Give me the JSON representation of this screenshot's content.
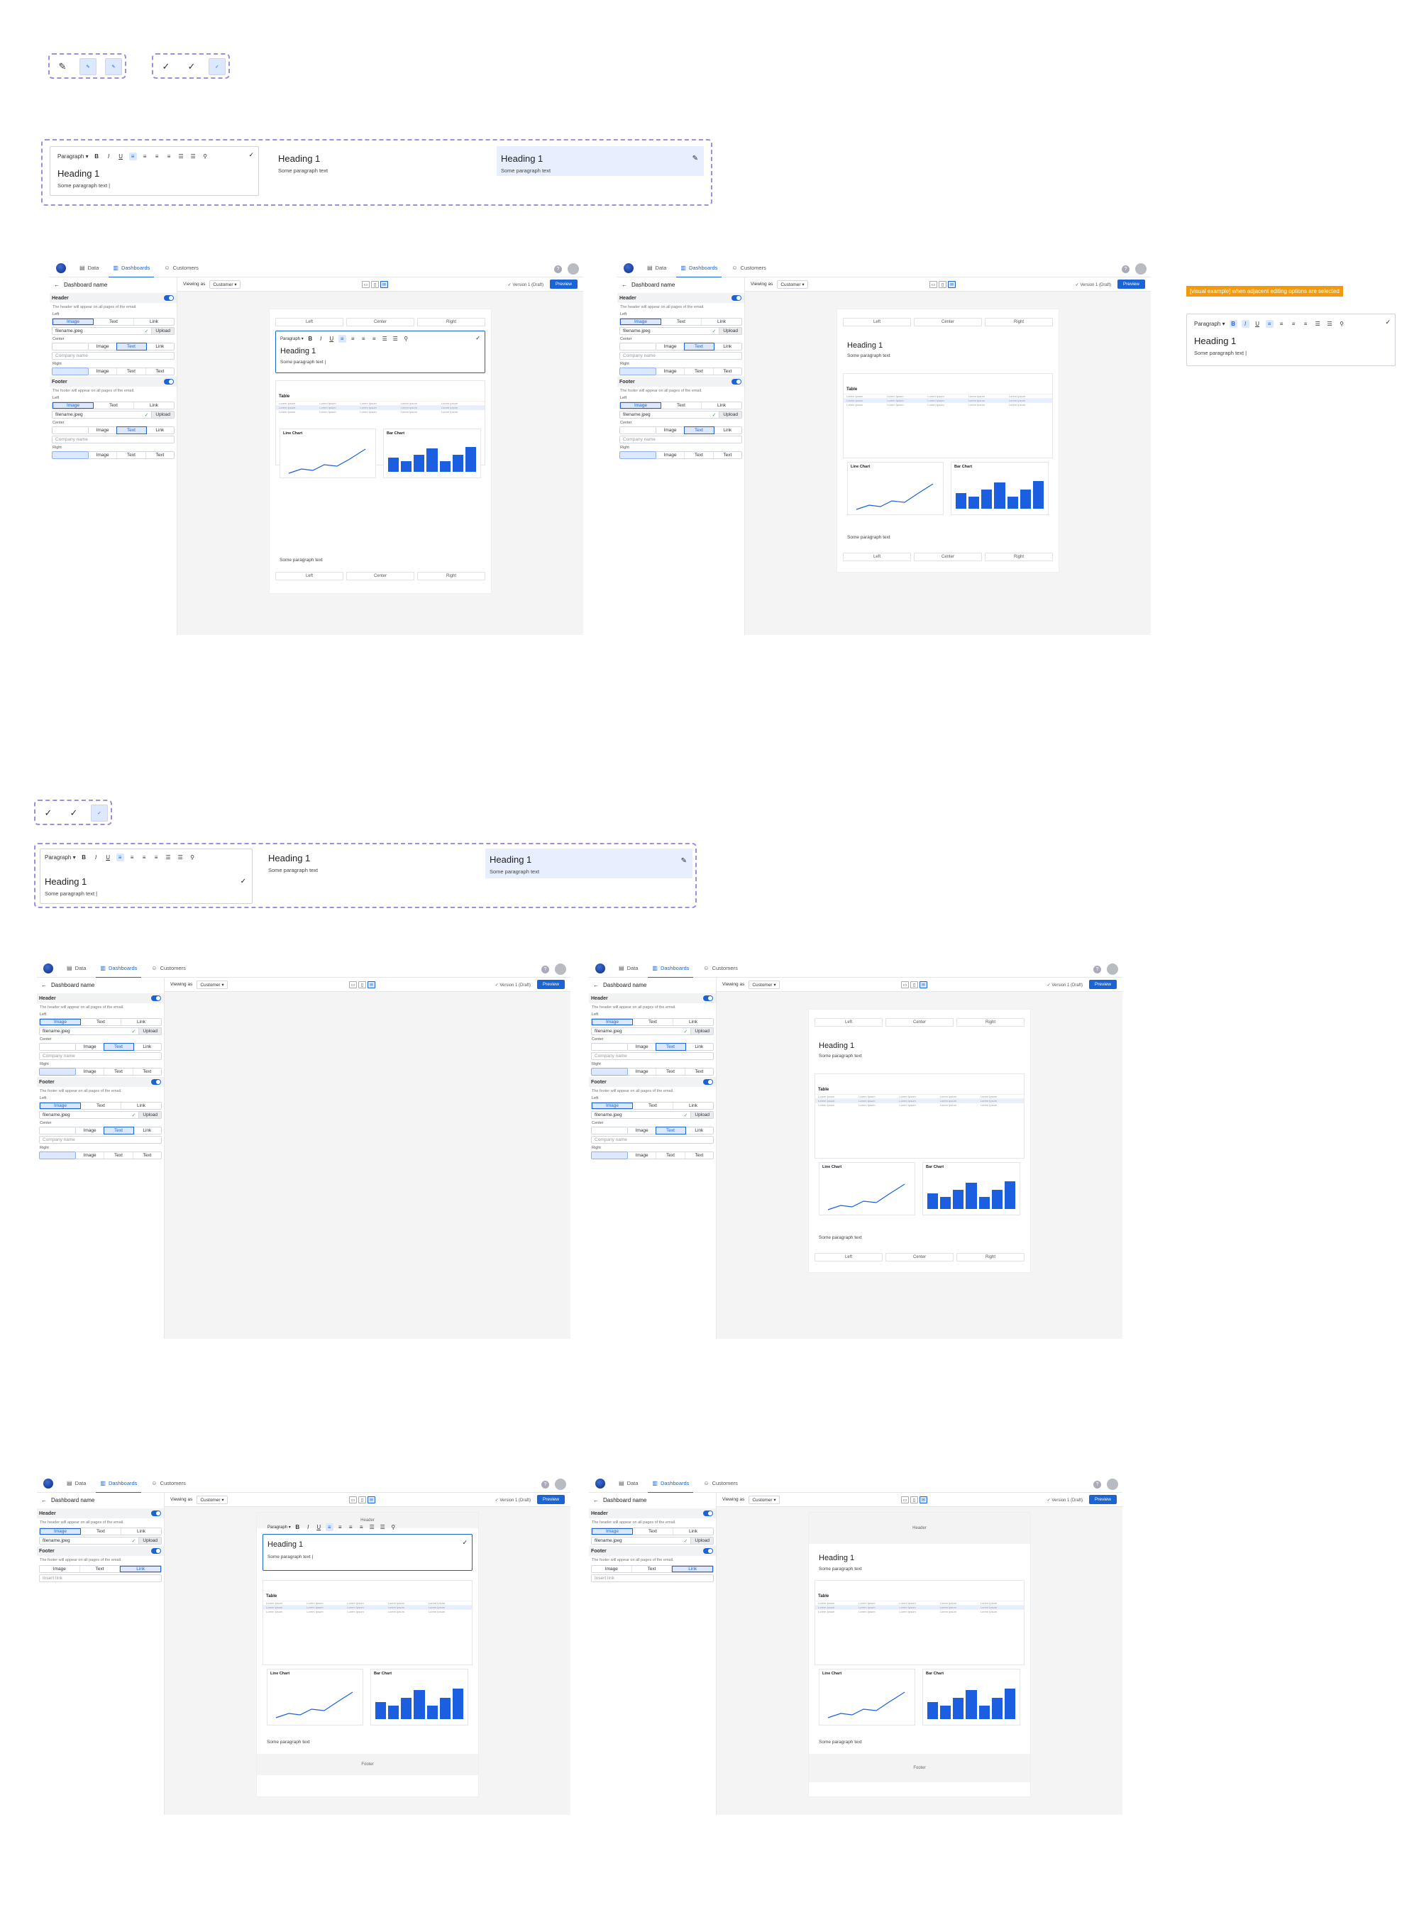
{
  "paragraph_label": "Paragraph",
  "heading": "Heading 1",
  "paragraph_text": "Some paragraph text",
  "paragraph_cursor": "Some paragraph text |",
  "note": "[visual example] when adjacent editing options are selected",
  "app": {
    "nav": [
      "Data",
      "Dashboards",
      "Customers"
    ],
    "dashboard_name": "Dashboard name",
    "viewing_as": "Viewing as",
    "viewer": "Customer",
    "version": "Version 1 (Draft)",
    "preview": "Preview"
  },
  "sidebar": {
    "header": "Header",
    "footer": "Footer",
    "header_hint": "The header will appear on all pages of the email.",
    "footer_hint": "The footer will appear on all pages of the email.",
    "left": "Left",
    "center": "Center",
    "right": "Right",
    "image": "Image",
    "text": "Text",
    "link": "Link",
    "filename": "filename.jpeg",
    "upload": "Upload",
    "company": "Company name",
    "insert_link": "Insert link"
  },
  "canvas": {
    "left": "Left",
    "center": "Center",
    "right": "Right",
    "table": "Table",
    "line_chart": "Line Chart",
    "bar_chart": "Bar Chart",
    "header": "Header",
    "footer": "Footer",
    "cell": "Lorem Ipsum"
  },
  "bar_values": [
    0.45,
    0.35,
    0.55,
    0.75,
    0.35,
    0.55,
    0.8
  ]
}
